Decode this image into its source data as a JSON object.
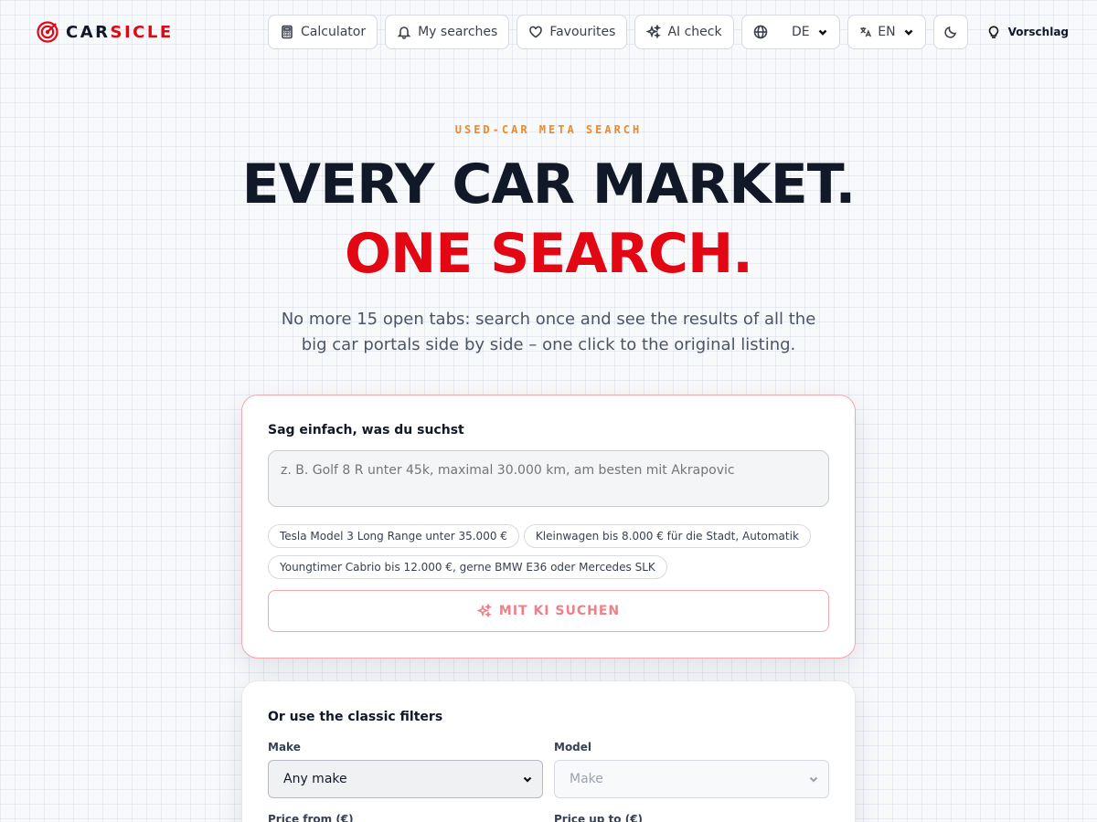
{
  "brand": {
    "name_part1": "CAR",
    "name_part2": "SICLE",
    "accent_color": "#e30613"
  },
  "nav": {
    "calculator": "Calculator",
    "my_searches": "My searches",
    "favourites": "Favourites",
    "ai_check": "AI check",
    "country": "DE",
    "language": "EN",
    "suggestion": "Vorschlag"
  },
  "hero": {
    "eyebrow": "USED-CAR META SEARCH",
    "line1": "EVERY CAR MARKET.",
    "line2": "ONE SEARCH.",
    "subtitle": "No more 15 open tabs: search once and see the results of all the big car portals side by side – one click to the original listing."
  },
  "ai_search": {
    "title": "Sag einfach, was du suchst",
    "placeholder": "z. B. Golf 8 R unter 45k, maximal 30.000 km, am besten mit Akrapovic",
    "suggestions": [
      "Tesla Model 3 Long Range unter 35.000 €",
      "Kleinwagen bis 8.000 € für die Stadt, Automatik",
      "Youngtimer Cabrio bis 12.000 €, gerne BMW E36 oder Mercedes SLK"
    ],
    "button": "MIT KI SUCHEN"
  },
  "filters": {
    "title": "Or use the classic filters",
    "make_label": "Make",
    "make_value": "Any make",
    "model_label": "Model",
    "model_value": "Make",
    "price_from_label": "Price from (€)",
    "price_to_label": "Price up to (€)"
  }
}
